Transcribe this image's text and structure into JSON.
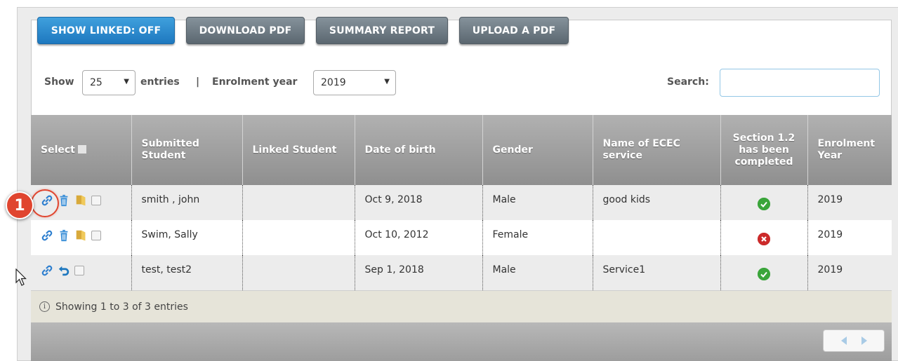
{
  "toolbar": {
    "show_linked": "SHOW LINKED: OFF",
    "download_pdf": "DOWNLOAD PDF",
    "summary_report": "SUMMARY REPORT",
    "upload_pdf": "UPLOAD A PDF"
  },
  "controls": {
    "show_label": "Show",
    "entries_value": "25",
    "entries_label": "entries",
    "separator": "|",
    "year_label": "Enrolment year",
    "year_value": "2019",
    "search_label": "Search:",
    "search_value": ""
  },
  "table": {
    "headers": {
      "select": "Select",
      "submitted": "Submitted Student",
      "linked": "Linked Student",
      "dob": "Date of birth",
      "gender": "Gender",
      "service": "Name of ECEC service",
      "section": "Section 1.2 has been completed",
      "year": "Enrolment Year"
    },
    "rows": [
      {
        "submitted": "smith , john",
        "linked": "",
        "dob": "Oct 9, 2018",
        "gender": "Male",
        "service": "good kids",
        "completed": true,
        "year": "2019"
      },
      {
        "submitted": "Swim, Sally",
        "linked": "",
        "dob": "Oct 10, 2012",
        "gender": "Female",
        "service": "",
        "completed": false,
        "year": "2019"
      },
      {
        "submitted": "test, test2",
        "linked": "",
        "dob": "Sep 1, 2018",
        "gender": "Male",
        "service": "Service1",
        "completed": true,
        "year": "2019"
      }
    ]
  },
  "footer": {
    "info": "Showing 1 to 3 of 3 entries"
  },
  "callout": {
    "number": "1"
  },
  "colors": {
    "link_icon": "#2e7fcf",
    "trash_icon": "#3a8fd8",
    "folder_icon": "#d8a93a",
    "status_ok": "#3aa53a",
    "status_bad": "#cc2a2a"
  }
}
